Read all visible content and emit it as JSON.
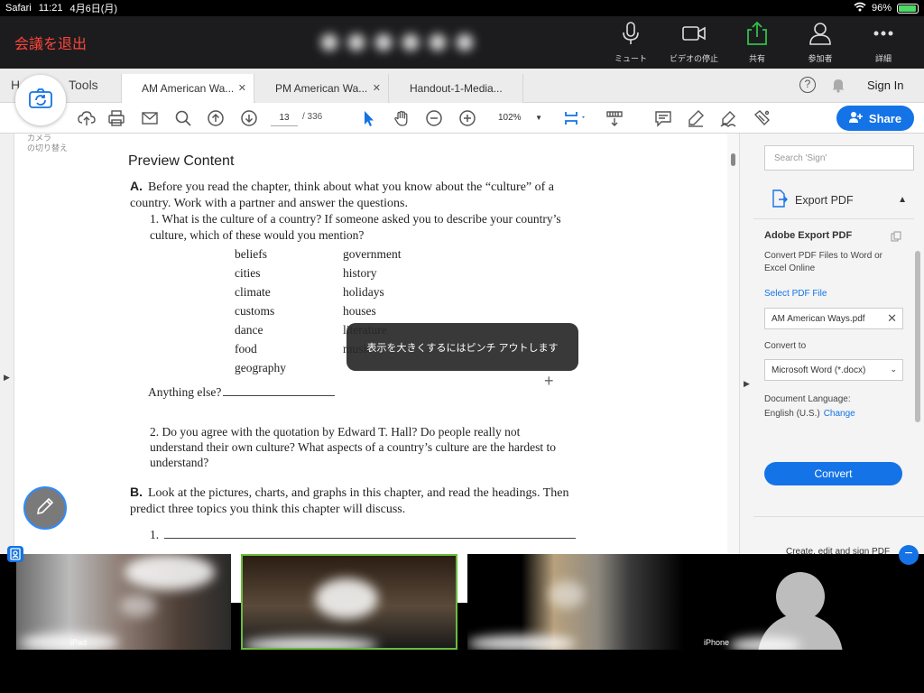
{
  "status_bar": {
    "app": "Safari",
    "time": "11:21",
    "date": "4月6日(月)",
    "battery_pct": "96%",
    "battery_level": 0.96
  },
  "zoom_bar": {
    "leave_label": "会議を退出",
    "buttons": [
      {
        "label": "ミュート",
        "icon": "microphone-icon"
      },
      {
        "label": "ビデオの停止",
        "icon": "video-camera-icon"
      },
      {
        "label": "共有",
        "icon": "share-upload-icon"
      },
      {
        "label": "参加者",
        "icon": "participants-icon"
      },
      {
        "label": "詳細",
        "icon": "more-icon"
      }
    ]
  },
  "acrobat": {
    "home_tab": "H",
    "tools_tab": "Tools",
    "doc_tabs": [
      "AM American Wa...",
      "PM American Wa...",
      "Handout-1-Media..."
    ],
    "sign_in": "Sign In",
    "page_current": "13",
    "page_total": "/ 336",
    "zoom_level": "102%",
    "share_label": "Share"
  },
  "camera_switch": {
    "label": "カメラ\nの切り替え"
  },
  "document": {
    "heading": "Preview Content",
    "qA_letter": "A.",
    "qA_text": "Before you read the chapter, think about what you know about the “culture” of a country. Work with a partner and answer the questions.",
    "q1_text": "1.  What is the culture of a country? If someone asked you to describe your country’s culture, which of these would you mention?",
    "words_col1": [
      "beliefs",
      "cities",
      "climate",
      "customs",
      "dance",
      "food",
      "geography"
    ],
    "words_col2": [
      "government",
      "history",
      "holidays",
      "houses",
      "literature",
      "music"
    ],
    "anything_else": "Anything else?",
    "q2_text": "2.  Do you agree with the quotation by Edward T. Hall? Do people really not understand their own culture? What aspects of a country’s culture are the hardest to understand?",
    "qB_letter": "B.",
    "qB_text": "Look at the pictures, charts, and graphs in this chapter, and read the headings. Then predict three topics you think this chapter will discuss.",
    "item1": "1."
  },
  "toast": "表示を大きくするにはピンチ アウトします",
  "right_panel": {
    "search_placeholder": "Search 'Sign'",
    "export_header": "Export PDF",
    "title": "Adobe Export PDF",
    "description": "Convert PDF Files to Word or Excel Online",
    "select_link": "Select PDF File",
    "file_name": "AM American Ways.pdf",
    "convert_to_label": "Convert to",
    "convert_format": "Microsoft Word (*.docx)",
    "doc_language_label": "Document Language:",
    "doc_language_value": "English (U.S.)",
    "change_link": "Change",
    "convert_button": "Convert",
    "footer": "Create, edit and sign PDF"
  },
  "video_strip": {
    "tiles": [
      {
        "name": "iPad"
      },
      {
        "name": ""
      },
      {
        "name": ""
      },
      {
        "name": "iPhone"
      }
    ]
  },
  "colors": {
    "leave": "#ff453a",
    "accent": "#1473e6",
    "active_speaker": "#6cbb3c",
    "share_green": "#31c048"
  }
}
